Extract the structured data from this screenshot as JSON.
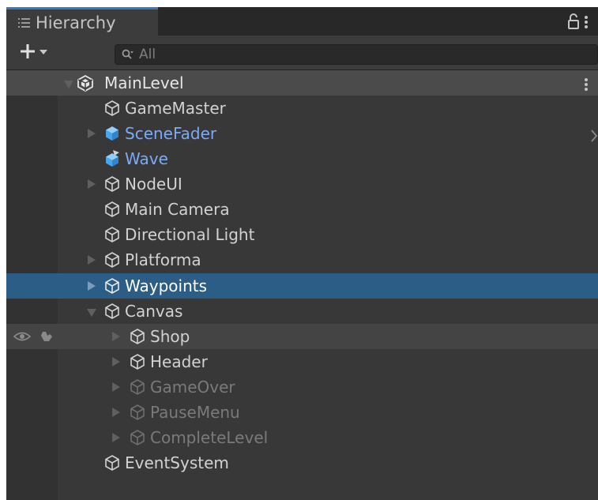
{
  "panel": {
    "tab_title": "Hierarchy",
    "accent_color": "#3a79bb",
    "background_color": "#383838",
    "selection_color": "#2c5d87",
    "prefab_text_color": "#7baaf7"
  },
  "toolbar": {
    "search_placeholder": "All"
  },
  "scene": {
    "name": "MainLevel"
  },
  "tree": {
    "items": [
      {
        "label": "GameMaster",
        "expanded": false,
        "has_children": false,
        "prefab": false,
        "active": true
      },
      {
        "label": "SceneFader",
        "expanded": false,
        "has_children": true,
        "prefab": true,
        "active": true
      },
      {
        "label": "Wave",
        "expanded": false,
        "has_children": false,
        "prefab": true,
        "active": true
      },
      {
        "label": "NodeUI",
        "expanded": false,
        "has_children": true,
        "prefab": false,
        "active": true
      },
      {
        "label": "Main Camera",
        "expanded": false,
        "has_children": false,
        "prefab": false,
        "active": true
      },
      {
        "label": "Directional Light",
        "expanded": false,
        "has_children": false,
        "prefab": false,
        "active": true
      },
      {
        "label": "Platforma",
        "expanded": false,
        "has_children": true,
        "prefab": false,
        "active": true
      },
      {
        "label": "Waypoints",
        "expanded": false,
        "has_children": true,
        "prefab": false,
        "active": true,
        "selected": true
      },
      {
        "label": "Canvas",
        "expanded": true,
        "has_children": true,
        "prefab": false,
        "active": true
      },
      {
        "label": "Shop",
        "expanded": false,
        "has_children": true,
        "prefab": false,
        "active": true,
        "hovered": true
      },
      {
        "label": "Header",
        "expanded": false,
        "has_children": true,
        "prefab": false,
        "active": true
      },
      {
        "label": "GameOver",
        "expanded": false,
        "has_children": true,
        "prefab": false,
        "active": false
      },
      {
        "label": "PauseMenu",
        "expanded": false,
        "has_children": true,
        "prefab": false,
        "active": false
      },
      {
        "label": "CompleteLevel",
        "expanded": false,
        "has_children": true,
        "prefab": false,
        "active": false
      },
      {
        "label": "EventSystem",
        "expanded": false,
        "has_children": false,
        "prefab": false,
        "active": true
      }
    ]
  }
}
